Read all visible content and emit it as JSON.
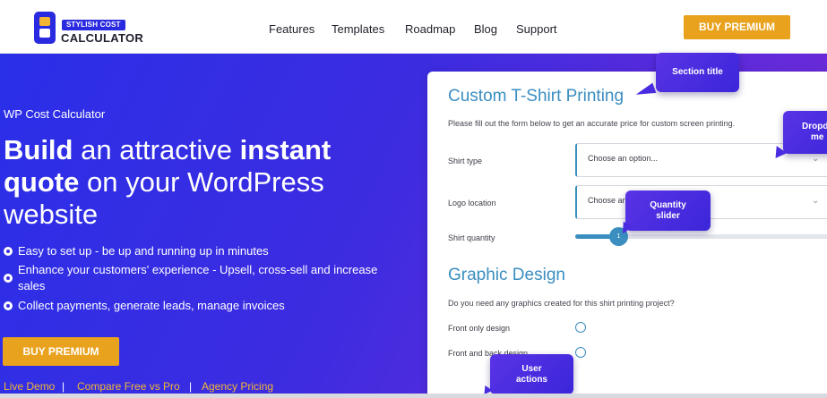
{
  "header": {
    "logo_badge": "STYLISH COST",
    "logo_word": "CALCULATOR",
    "nav": [
      "Features",
      "Templates",
      "Roadmap",
      "Blog",
      "Support"
    ],
    "cta": "BUY PREMIUM"
  },
  "hero": {
    "eyebrow": "WP Cost Calculator",
    "headline": {
      "w1": "Build",
      "w2": " an attractive ",
      "w3": "instant",
      "w4": "quote",
      "w5": " on your WordPress",
      "w6": "website"
    },
    "features": [
      "Easy to set up - be up and running up in minutes",
      "Enhance your customers' experience - Upsell, cross-sell and increase",
      "sales",
      "Collect payments, generate leads, manage invoices"
    ],
    "cta": "BUY PREMIUM",
    "links": [
      "Live Demo",
      "Compare Free vs Pro",
      "Agency Pricing"
    ],
    "link_separator": "|"
  },
  "form": {
    "title": "Custom T-Shirt Printing",
    "description": "Please fill out the form below to get an accurate price for custom screen printing.",
    "fields": {
      "shirt_type": {
        "label": "Shirt type",
        "value": "Choose an option..."
      },
      "logo_location": {
        "label": "Logo location",
        "value": "Choose an"
      },
      "shirt_quantity": {
        "label": "Shirt quantity",
        "value": "1"
      }
    },
    "section2_title": "Graphic Design",
    "question": "Do you need any graphics created for this shirt printing project?",
    "options": [
      "Front only design",
      "Front and back design"
    ],
    "chevron": "⌄"
  },
  "callouts": {
    "section_title": "Section title",
    "dropdown_line1": "Dropd",
    "dropdown_line2": "me",
    "quantity_line1": "Quantity",
    "quantity_line2": "slider",
    "user_line1": "User",
    "user_line2": "actions"
  },
  "colors": {
    "accent": "#e9a21e",
    "hero_blue": "#2a2fe8",
    "hero_purple": "#7a2ad6",
    "form_accent": "#3a8ec0",
    "callout": "#4a2ce0"
  }
}
